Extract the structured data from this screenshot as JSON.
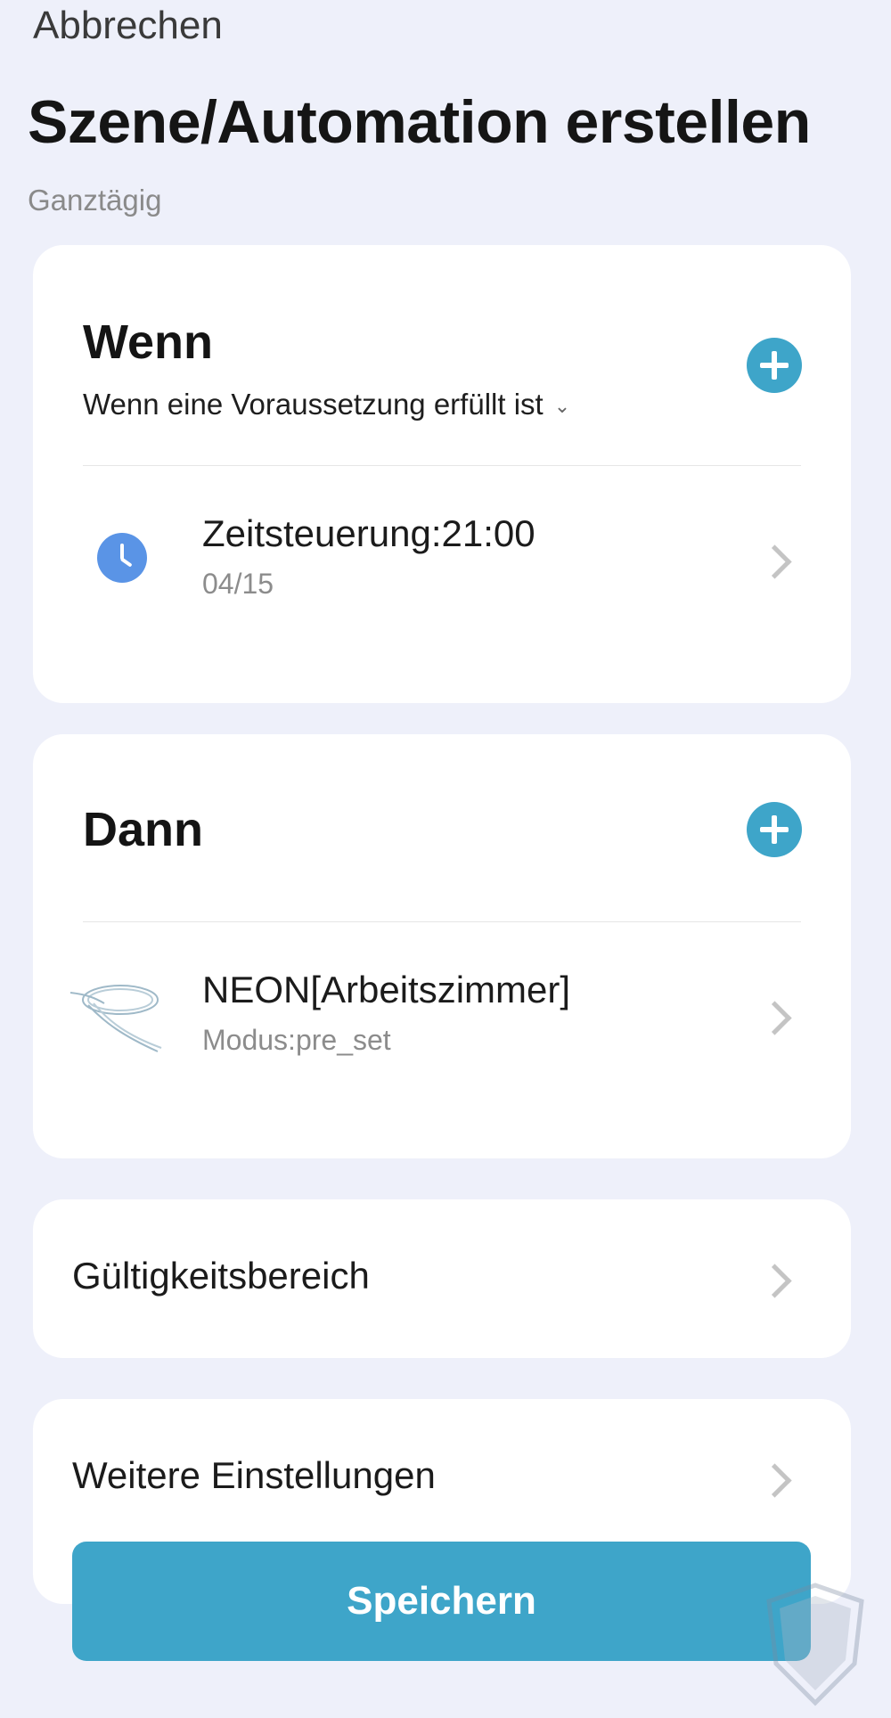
{
  "header": {
    "cancel_label": "Abbrechen",
    "title": "Szene/Automation erstellen",
    "subtitle": "Ganztägig"
  },
  "wenn": {
    "title": "Wenn",
    "condition_mode": "Wenn eine Voraussetzung erfüllt ist",
    "items": [
      {
        "icon": "clock-icon",
        "title": "Zeitsteuerung:21:00",
        "subtitle": "04/15"
      }
    ]
  },
  "dann": {
    "title": "Dann",
    "items": [
      {
        "icon": "neon-strip-icon",
        "title": "NEON[Arbeitszimmer]",
        "subtitle": "Modus:pre_set"
      }
    ]
  },
  "settings": {
    "scope_label": "Gültigkeitsbereich",
    "more_label": "Weitere Einstellungen"
  },
  "footer": {
    "save_label": "Speichern"
  },
  "colors": {
    "accent": "#3ea5c9",
    "background": "#eef0fa",
    "clock_icon": "#5a94e6"
  }
}
